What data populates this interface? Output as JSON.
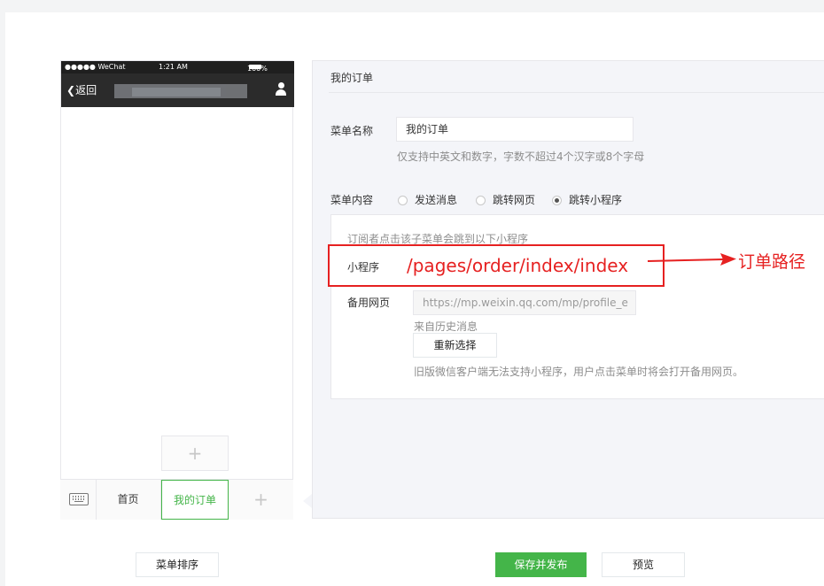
{
  "phone": {
    "carrier": "●●●●● WeChat",
    "time": "1:21 AM",
    "battery": "100%",
    "back_label": "返回"
  },
  "menu": {
    "items": [
      {
        "label": "首页"
      },
      {
        "label": "我的订单"
      }
    ],
    "add_symbol": "+"
  },
  "panel": {
    "title": "我的订单",
    "name_label": "菜单名称",
    "name_value": "我的订单",
    "name_hint": "仅支持中英文和数字，字数不超过4个汉字或8个字母",
    "content_label": "菜单内容",
    "options": [
      "发送消息",
      "跳转网页",
      "跳转小程序"
    ],
    "selected_option": "跳转小程序",
    "box": {
      "intro": "订阅者点击该子菜单会跳到以下小程序",
      "miniprogram_label": "小程序",
      "miniprogram_path": "/pages/order/index/index",
      "backup_label": "备用网页",
      "backup_url": "https://mp.weixin.qq.com/mp/profile_e",
      "history_label": "来自历史消息",
      "reselect_label": "重新选择",
      "old_client_hint": "旧版微信客户端无法支持小程序，用户点击菜单时将会打开备用网页。"
    }
  },
  "annotation": {
    "label": "订单路径",
    "color": "#e62121"
  },
  "buttons": {
    "sort": "菜单排序",
    "save": "保存并发布",
    "preview": "预览"
  },
  "colors": {
    "accent": "#44b549",
    "annotation": "#e62121"
  }
}
